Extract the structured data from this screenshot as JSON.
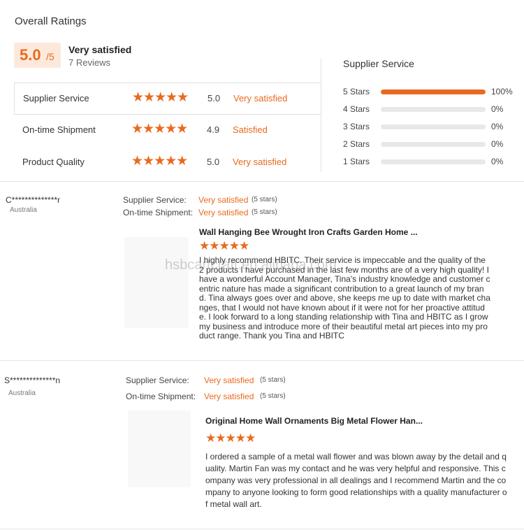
{
  "overall": {
    "title": "Overall Ratings",
    "score": "5.0",
    "score_max": "/5",
    "label": "Very satisfied",
    "reviews": "7 Reviews"
  },
  "ratings": [
    {
      "label": "Supplier Service",
      "stars": "★★★★★",
      "score": "5.0",
      "desc": "Very satisfied"
    },
    {
      "label": "On-time Shipment",
      "stars": "★★★★★",
      "score": "4.9",
      "desc": "Satisfied"
    },
    {
      "label": "Product Quality",
      "stars": "★★★★★",
      "score": "5.0",
      "desc": "Very satisfied"
    }
  ],
  "distribution": {
    "title": "Supplier Service",
    "rows": [
      {
        "label": "5  Stars",
        "pct": "100%",
        "value": 1.0
      },
      {
        "label": "4  Stars",
        "pct": "0%",
        "value": 0
      },
      {
        "label": "3  Stars",
        "pct": "0%",
        "value": 0
      },
      {
        "label": "2  Stars",
        "pct": "0%",
        "value": 0
      },
      {
        "label": "1  Stars",
        "pct": "0%",
        "value": 0
      }
    ]
  },
  "reviews": [
    {
      "name": "C**************r",
      "country": "Australia",
      "service_label": "Supplier Service:",
      "service_value": "Very satisfied",
      "service_stars": "(5 stars)",
      "shipment_label": "On-time Shipment:",
      "shipment_value": "Very satisfied",
      "shipment_stars": "(5 stars)",
      "product": "Wall Hanging Bee Wrought Iron Crafts Garden Home ...",
      "stars": "★★★★★",
      "text": "I highly recommend HBITC. Their service is impeccable and the quality of the 2 products I have purchased in the last few months are of a very high quality! I have a wonderful Account Manager, Tina's industry knowledge and customer centric nature has made a significant contribution to a great launch of my brand. Tina always goes over and above, she keeps me up to date with market changes, that I would not have known about if it were not for her proactive attitude. I look forward to a long standing relationship with Tina and HBITC as I grow my business and introduce more of their beautiful metal art pieces into my product range. Thank you Tina and HBITC"
    },
    {
      "name": "S**************n",
      "country": "Australia",
      "service_label": "Supplier Service:",
      "service_value": "Very satisfied",
      "service_stars": "(5 stars)",
      "shipment_label": "On-time Shipment:",
      "shipment_value": "Very satisfied",
      "shipment_stars": "(5 stars)",
      "product": "Original Home Wall Ornaments Big Metal Flower Han...",
      "stars": "★★★★★",
      "text": "I ordered a sample of a metal wall flower and was blown away by the detail and quality. Martin Fan was my contact and he was very helpful and responsive. This company was very professional in all dealings and I recommend Martin and the company to anyone looking to form good relationships with a quality manufacturer of metal wall art."
    }
  ],
  "watermark": "hsbcartcraft.en.alibaba.com",
  "colors": {
    "accent": "#e86a1f",
    "score_bg": "#fde9dc"
  }
}
